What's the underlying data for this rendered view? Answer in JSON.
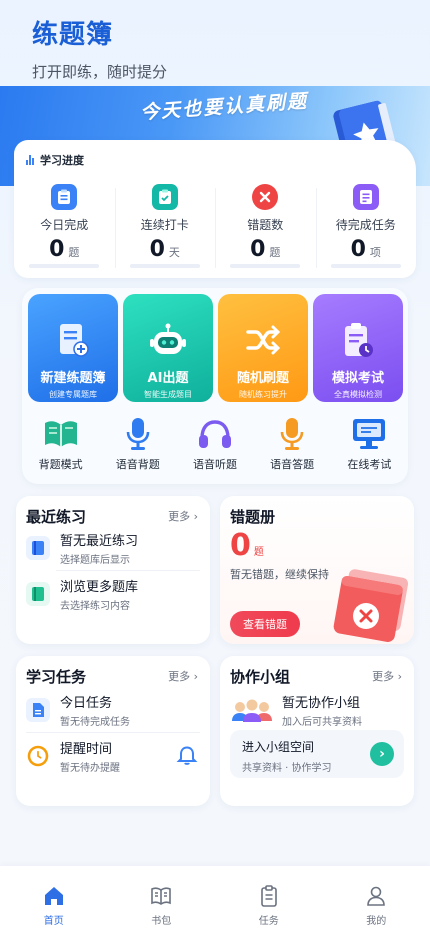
{
  "header": {
    "title": "练题簿",
    "subtitle": "打开即练，随时提分"
  },
  "banner": {
    "slogan": "今天也要认真刷题"
  },
  "progress": {
    "title": "学习进度",
    "stats": [
      {
        "label": "今日完成",
        "value": "0",
        "unit": "题",
        "icon": "clipboard-icon",
        "color": "#3b82f6"
      },
      {
        "label": "连续打卡",
        "value": "0",
        "unit": "天",
        "icon": "checkin-icon",
        "color": "#14b8a6"
      },
      {
        "label": "错题数",
        "value": "0",
        "unit": "题",
        "icon": "error-icon",
        "color": "#ef4444"
      },
      {
        "label": "待完成任务",
        "value": "0",
        "unit": "项",
        "icon": "task-list-icon",
        "color": "#8b5cf6"
      }
    ]
  },
  "actions": {
    "tiles": [
      {
        "title": "新建练题簿",
        "subtitle": "创建专属题库",
        "icon": "new-book-icon"
      },
      {
        "title": "AI出题",
        "subtitle": "智能生成题目",
        "icon": "robot-icon"
      },
      {
        "title": "随机刷题",
        "subtitle": "随机练习提升",
        "icon": "shuffle-icon"
      },
      {
        "title": "模拟考试",
        "subtitle": "全真模拟检测",
        "icon": "exam-clipboard-icon"
      }
    ],
    "quick": [
      {
        "label": "背题模式",
        "icon": "open-book-icon"
      },
      {
        "label": "语音背题",
        "icon": "microphone-icon"
      },
      {
        "label": "语音听题",
        "icon": "headphones-icon"
      },
      {
        "label": "语音答题",
        "icon": "microphone-orange-icon"
      },
      {
        "label": "在线考试",
        "icon": "monitor-icon"
      }
    ]
  },
  "recent": {
    "title": "最近练习",
    "more": "更多 ›",
    "items": [
      {
        "title": "暂无最近练习",
        "subtitle": "选择题库后显示"
      },
      {
        "title": "浏览更多题库",
        "subtitle": "去选择练习内容"
      }
    ]
  },
  "wrong_book": {
    "title": "错题册",
    "count": "0",
    "unit": "题",
    "description": "暂无错题，继续保持",
    "button": "查看错题"
  },
  "tasks": {
    "title": "学习任务",
    "more": "更多 ›",
    "items": [
      {
        "title": "今日任务",
        "subtitle": "暂无待完成任务"
      },
      {
        "title": "提醒时间",
        "subtitle": "暂无待办提醒"
      }
    ]
  },
  "group": {
    "title": "协作小组",
    "more": "更多 ›",
    "empty_title": "暂无协作小组",
    "empty_subtitle": "加入后可共享资料",
    "join_title": "进入小组空间",
    "join_subtitle": "共享资料 · 协作学习"
  },
  "nav": {
    "items": [
      {
        "label": "首页",
        "icon": "home-icon",
        "active": true
      },
      {
        "label": "书包",
        "icon": "book-icon",
        "active": false
      },
      {
        "label": "任务",
        "icon": "task-icon",
        "active": false
      },
      {
        "label": "我的",
        "icon": "user-icon",
        "active": false
      }
    ]
  },
  "colors": {
    "brand": "#1b5fd6",
    "accent_blue": "#2f6fe6",
    "error": "#ef4444",
    "teal": "#1fbf9f"
  }
}
